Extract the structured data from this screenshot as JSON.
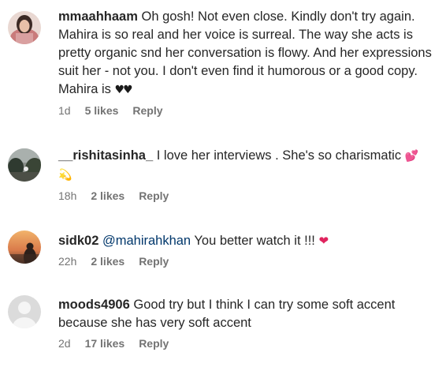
{
  "comments": [
    {
      "username": "mmaahhaam",
      "text_before_emoji": "Oh gosh! Not even close. Kindly don't try again. Mahira is so real and her voice is surreal. The way she acts is pretty organic snd her conversation is flowy. And her expressions suit her - not you. I don't even find it humorous or a good copy. Mahira is",
      "emoji": "♥♥",
      "time": "1d",
      "likes": "5 likes",
      "reply_label": "Reply",
      "avatar_icon": "profile-photo-woman-icon"
    },
    {
      "username": "__rishitasinha_",
      "text_before_emoji": "I love her interviews . She's so charismatic",
      "emoji": "💕",
      "emoji2": "💫",
      "time": "18h",
      "likes": "2 likes",
      "reply_label": "Reply",
      "avatar_icon": "profile-photo-landscape-icon"
    },
    {
      "username": "sidk02",
      "mention": "@mahirahkhan",
      "text_after_mention": "You better watch it !!!",
      "emoji": "❤",
      "time": "22h",
      "likes": "2 likes",
      "reply_label": "Reply",
      "avatar_icon": "profile-photo-sunset-icon"
    },
    {
      "username": "moods4906",
      "text_before_emoji": "Good try but I think I can try some soft accent because she has very soft accent",
      "time": "2d",
      "likes": "17 likes",
      "reply_label": "Reply",
      "avatar_icon": "default-avatar-icon"
    }
  ],
  "colors": {
    "text": "#262626",
    "meta": "#737373",
    "mention": "#00376b",
    "heart": "#e0245e"
  }
}
